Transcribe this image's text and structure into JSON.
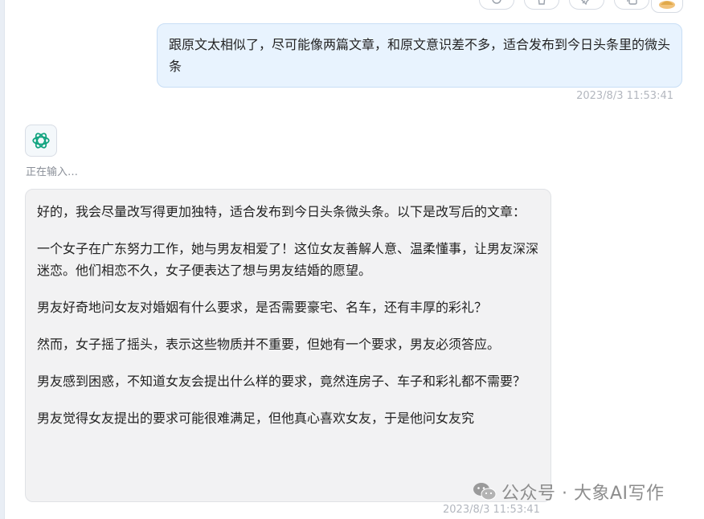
{
  "user_message": {
    "text": "跟原文太相似了，尽可能像两篇文章，和原文意识差不多，适合发布到今日头条里的微头条",
    "timestamp": "2023/8/3 11:53:41"
  },
  "bot": {
    "status": "正在输入…",
    "paragraphs": [
      "好的，我会尽量改写得更加独特，适合发布到今日头条微头条。以下是改写后的文章：",
      "一个女子在广东努力工作，她与男友相爱了！这位女友善解人意、温柔懂事，让男友深深迷恋。他们相恋不久，女子便表达了想与男友结婚的愿望。",
      "男友好奇地问女友对婚姻有什么要求，是否需要豪宅、名车，还有丰厚的彩礼？",
      "然而，女子摇了摇头，表示这些物质并不重要，但她有一个要求，男友必须答应。",
      "男友感到困惑，不知道女友会提出什么样的要求，竟然连房子、车子和彩礼都不需要？",
      "男友觉得女友提出的要求可能很难满足，但他真心喜欢女友，于是他问女友究"
    ],
    "timestamp": "2023/8/3 11:53:41"
  },
  "watermark": {
    "text": "公众号 · 大象AI写作"
  },
  "icons": {
    "top_actions": [
      "refresh-icon",
      "trash-icon",
      "pin-icon",
      "copy-icon"
    ],
    "user_avatar": "user-avatar-icon",
    "bot_avatar": "openai-logo-icon",
    "watermark_icon": "wechat-icon"
  },
  "colors": {
    "user_bubble_bg": "#e8f3fe",
    "bot_bubble_bg": "#f2f2f3",
    "bot_logo": "#10a37f"
  }
}
